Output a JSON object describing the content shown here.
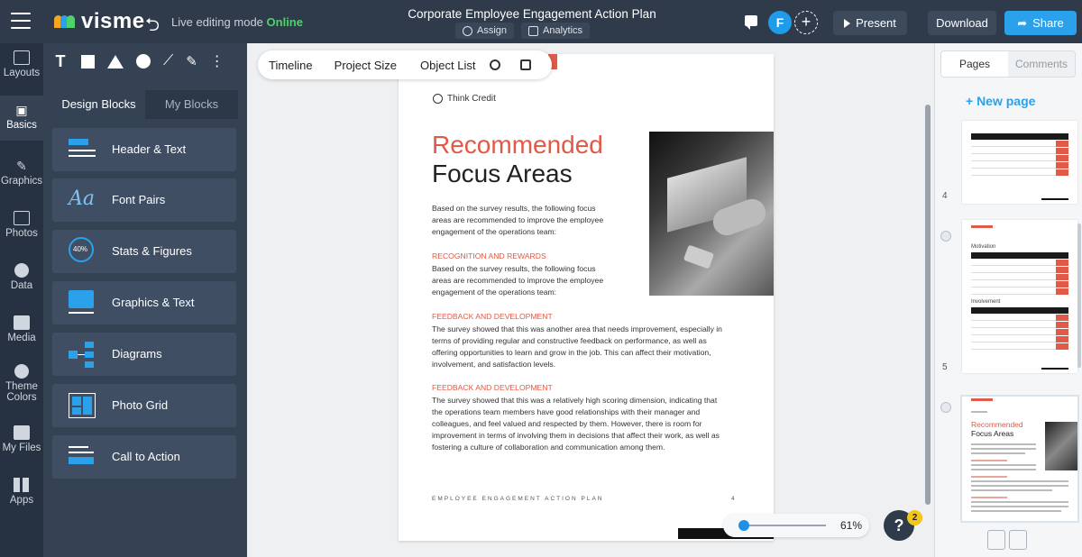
{
  "header": {
    "logo_text": "visme",
    "live_label": "Live editing mode",
    "live_status": "Online",
    "doc_title": "Corporate Employee Engagement Action Plan",
    "assign_label": "Assign",
    "analytics_label": "Analytics",
    "avatar_initial": "F",
    "present_label": "Present",
    "download_label": "Download",
    "share_label": "Share"
  },
  "rail": {
    "items": [
      {
        "label": "Layouts",
        "icon": "layouts-icon"
      },
      {
        "label": "Basics",
        "icon": "basics-icon"
      },
      {
        "label": "Graphics",
        "icon": "graphics-icon"
      },
      {
        "label": "Photos",
        "icon": "photos-icon"
      },
      {
        "label": "Data",
        "icon": "data-icon"
      },
      {
        "label": "Media",
        "icon": "media-icon"
      },
      {
        "label": "Theme Colors",
        "icon": "theme-colors-icon"
      },
      {
        "label": "My Files",
        "icon": "my-files-icon"
      },
      {
        "label": "Apps",
        "icon": "apps-icon"
      }
    ]
  },
  "panel": {
    "tool_text": "T",
    "tabs": [
      {
        "label": "Design Blocks"
      },
      {
        "label": "My Blocks"
      }
    ],
    "blocks": [
      {
        "label": "Header & Text"
      },
      {
        "label": "Font Pairs"
      },
      {
        "label": "Stats & Figures"
      },
      {
        "label": "Graphics & Text"
      },
      {
        "label": "Diagrams"
      },
      {
        "label": "Photo Grid"
      },
      {
        "label": "Call to Action"
      }
    ],
    "stats_icon_text": "40%",
    "font_pair_icon_text": "Aa"
  },
  "canvas_bar": {
    "timeline": "Timeline",
    "project_size": "Project Size",
    "object_list": "Object List"
  },
  "page": {
    "brand": "Think Credit",
    "heading_red": "Recommended",
    "heading_dark": "Focus Areas",
    "intro": "Based on the survey results, the following focus areas are recommended to improve the employee engagement of the operations team:",
    "sections": [
      {
        "title": "RECOGNITION AND REWARDS",
        "body": "Based on the survey results, the following focus areas are recommended to improve the employee engagement of the operations team:"
      },
      {
        "title": "FEEDBACK AND DEVELOPMENT",
        "body": "The survey showed that this was another area that needs improvement, especially in terms of providing regular and constructive feedback on performance, as well as offering opportunities to learn and grow in the job. This can affect their motivation, involvement, and satisfaction levels."
      },
      {
        "title": "FEEDBACK AND DEVELOPMENT",
        "body": "The survey showed that this was a relatively high scoring dimension, indicating that the operations team members have good relationships with their manager and colleagues, and feel valued and respected by them. However, there is room for improvement in terms of involving them in decisions that affect their work, as well as fostering a culture of collaboration and communication among them."
      }
    ],
    "footer": "EMPLOYEE ENGAGEMENT ACTION PLAN",
    "page_number": "4"
  },
  "zoom": {
    "value": "61%",
    "level": 0.05
  },
  "help": {
    "label": "?",
    "badge": "2"
  },
  "right_panel": {
    "tabs": [
      {
        "label": "Pages"
      },
      {
        "label": "Comments"
      }
    ],
    "new_page": "+ New page",
    "page_numbers": [
      "4",
      "5"
    ],
    "thumb_motivation": "Motivation",
    "thumb_involvement": "Involvement",
    "thumb_red": "Recommended",
    "thumb_dark": "Focus Areas"
  },
  "colors": {
    "accent": "#e05a47",
    "topbar": "#2f3b4b",
    "share": "#2aa1ea",
    "online": "#4fd26b"
  }
}
